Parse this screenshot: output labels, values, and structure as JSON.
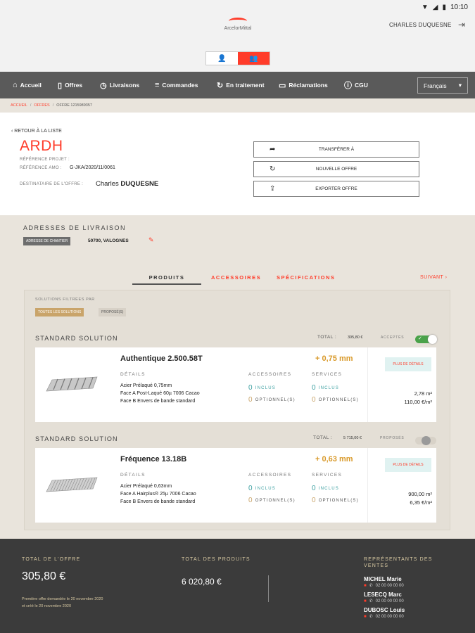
{
  "status_bar": {
    "time": "10:10",
    "icons": [
      "wifi-icon",
      "signal-icon",
      "battery-icon"
    ]
  },
  "header": {
    "logo_text": "ArcelorMittal",
    "user_name": "CHARLES DUQUESNE"
  },
  "nav": {
    "items": [
      {
        "label": "Accueil",
        "icon": "home-icon"
      },
      {
        "label": "Offres",
        "icon": "document-icon"
      },
      {
        "label": "Livraisons",
        "icon": "clock-icon"
      },
      {
        "label": "Commandes",
        "icon": "list-icon"
      },
      {
        "label": "En traitement",
        "icon": "refresh-icon"
      },
      {
        "label": "Réclamations",
        "icon": "chat-icon"
      },
      {
        "label": "CGU",
        "icon": "info-icon"
      }
    ],
    "language": "Français"
  },
  "breadcrumb": {
    "home": "ACCUEIL",
    "offers": "OFFRES",
    "current": "OFFRE 1215989357"
  },
  "offer": {
    "back_label": "RETOUR À LA LISTE",
    "code": "ARDH",
    "project_ref_label": "RÉFÉRENCE PROJET :",
    "amo_ref_label": "RÉFÉRENCE AMO :",
    "amo_ref_value": "G-JKA/2020/11/0061",
    "recipient_label": "DESTINATAIRE DE L'OFFRE :",
    "recipient_first": "Charles",
    "recipient_last": "DUQUESNE",
    "actions": {
      "transfer": "TRANSFÉRER À",
      "new_offer": "NOUVELLE OFFRE",
      "export": "EXPORTER OFFRE"
    }
  },
  "delivery": {
    "title": "ADRESSES DE LIVRAISON",
    "badge": "ADRESSE DE CHANTIER",
    "address": "50700, VALOGNES"
  },
  "tabs": {
    "products": "PRODUITS",
    "accessories": "ACCESSOIRES",
    "specifications": "SPÉCIFICATIONS",
    "next": "SUIVANT"
  },
  "filters": {
    "label": "SOLUTIONS FILTRÉES PAR",
    "all": "TOUTES LES SOLUTIONS",
    "proposed": "PROPOSÉ(S)"
  },
  "solutions": [
    {
      "title": "STANDARD SOLUTION",
      "total_label": "TOTAL :",
      "total_value": "305,80 €",
      "status": "ACCEPTÉS",
      "accepted": true,
      "product_name": "Authentique 2.500.58T",
      "thickness": "+ 0,75  mm",
      "details_header": "DÉTAILS",
      "details": [
        "Acier Prélaqué 0,75mm",
        "Face A Post-Laqué 60µ 7006 Cacao",
        "Face B Envers de bande standard"
      ],
      "accessories_header": "ACCESSOIRES",
      "services_header": "SERVICES",
      "acc_included": "0",
      "acc_optional": "0",
      "srv_included": "0",
      "srv_optional": "0",
      "included_label": "INCLUS",
      "optional_label": "OPTIONNEL(S)",
      "details_button": "PLUS DE DÉTAILS",
      "area": "2,78 m²",
      "unit_price": "110,00 €/m²"
    },
    {
      "title": "STANDARD SOLUTION",
      "total_label": "TOTAL :",
      "total_value": "5 715,00 €",
      "status": "PROPOSÉS",
      "accepted": false,
      "product_name": "Fréquence 13.18B",
      "thickness": "+ 0,63  mm",
      "details_header": "DÉTAILS",
      "details": [
        "Acier Prélaqué 0,63mm",
        "Face A Hairplus® 25µ 7006 Cacao",
        "Face B Envers de bande standard"
      ],
      "accessories_header": "ACCESSOIRES",
      "services_header": "SERVICES",
      "acc_included": "0",
      "acc_optional": "0",
      "srv_included": "0",
      "srv_optional": "0",
      "included_label": "INCLUS",
      "optional_label": "OPTIONNEL(S)",
      "details_button": "PLUS DE DÉTAILS",
      "area": "900,00 m²",
      "unit_price": "6,35 €/m²"
    }
  ],
  "footer": {
    "offer_total_label": "TOTAL DE L'OFFRE",
    "offer_total": "305,80 €",
    "note1": "Première offre demandée le 20 novembre 2020",
    "note2": "et créé le 20 novembre 2020",
    "products_total_label": "TOTAL DES PRODUITS",
    "products_total": "6 020,80 €",
    "reps_label_1": "REPRÉSENTANTS DES",
    "reps_label_2": "VENTES",
    "reps": [
      {
        "name": "MICHEL Marie",
        "phone": "02 00 00 00 00"
      },
      {
        "name": "LESECQ Marc",
        "phone": "02 00 00 00 00"
      },
      {
        "name": "DUBOSC Louis",
        "phone": "02 00 00 00 00"
      }
    ]
  },
  "colors": {
    "accent": "#ff3c2a",
    "nav_bg": "#5a5a5a",
    "beige": "#e9e4dc",
    "footer_bg": "#3b3b3b",
    "gold": "#d99a2b",
    "teal": "#3a9fa0"
  }
}
